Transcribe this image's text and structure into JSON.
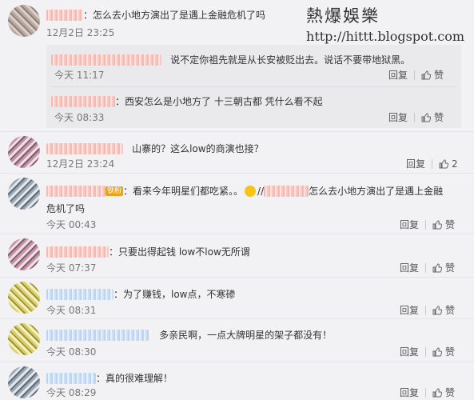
{
  "watermark": {
    "title": "熱爆娛樂",
    "url": "http://hittt.blogspot.com"
  },
  "comments": [
    {
      "text": "：怎么去小地方演出了是遇上金融危机了吗",
      "time": "12月2日 23:25"
    },
    {
      "text": "说不定你祖先就是从长安被贬出去。说话不要带地狱黑。",
      "time": "今天 11:17",
      "reply": "回复",
      "like": "赞"
    },
    {
      "text": "：西安怎么是小地方了 十三朝古都 凭什么看不起",
      "time": "今天 08:33",
      "reply": "回复",
      "like": "赞"
    },
    {
      "text": "山寨的？这么low的商演也接？",
      "time": "12月2日 23:24",
      "reply": "回复",
      "like": "2"
    },
    {
      "badge": "铁粉",
      "text_a": "：看来今年明星们都吃紧。。",
      "text_b": "//",
      "text_c": "怎么去小地方演出了是遇上金融",
      "text_d": "危机了吗",
      "time": "今天 00:43",
      "reply": "回复",
      "like": "赞"
    },
    {
      "text": "：只要出得起钱 low不low无所谓",
      "time": "今天 07:37",
      "reply": "回复",
      "like": "赞"
    },
    {
      "text": "：为了赚钱，low点，不寒碜",
      "time": "今天 08:31",
      "reply": "回复",
      "like": "赞"
    },
    {
      "text": "多亲民啊，一点大牌明星的架子都没有！",
      "time": "今天 08:30",
      "reply": "回复",
      "like": "赞"
    },
    {
      "text": "：真的很难理解！",
      "time": "今天 08:29",
      "reply": "回复",
      "like": "赞"
    }
  ]
}
